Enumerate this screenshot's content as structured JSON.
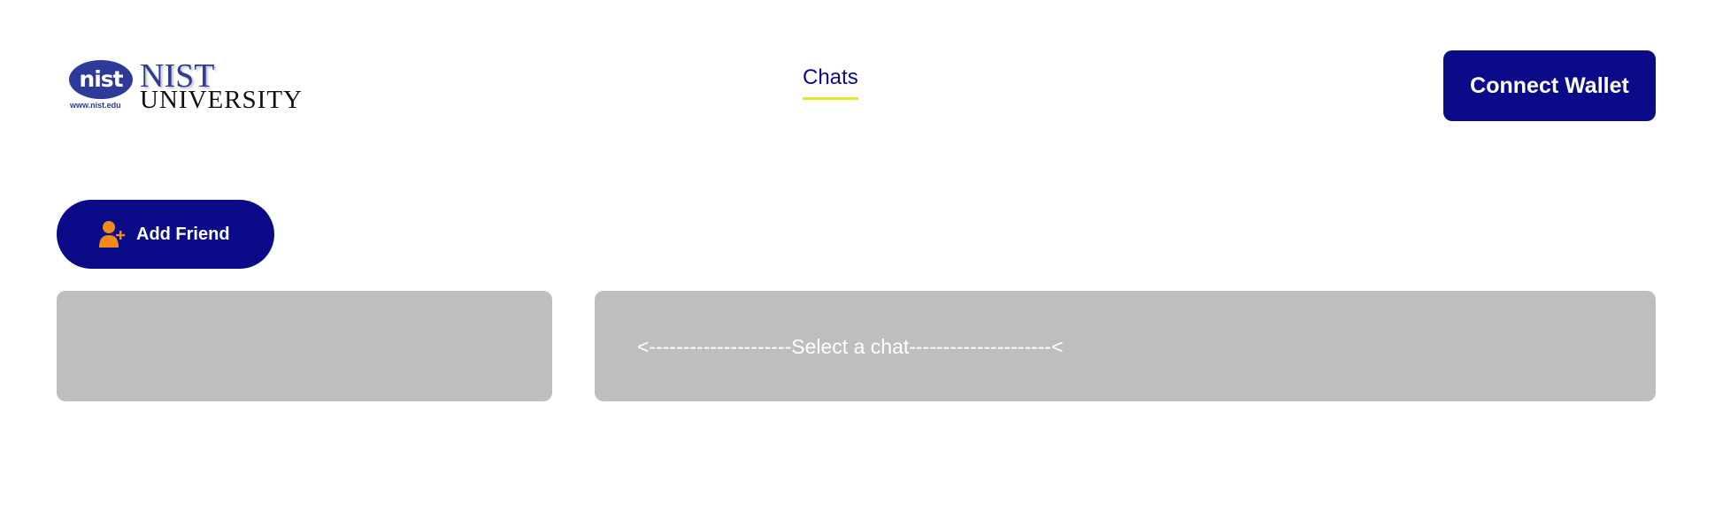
{
  "header": {
    "logo": {
      "mark_text": "nist",
      "url_text": "www.nist.edu",
      "name_line1": "NIST",
      "name_line2": "UNIVERSITY"
    },
    "nav": {
      "chats_label": "Chats"
    },
    "connect_wallet_label": "Connect Wallet"
  },
  "actions": {
    "add_friend_label": "Add Friend",
    "add_friend_icon": "add-user-icon"
  },
  "chat": {
    "placeholder": "<---------------------Select a chat---------------------<"
  },
  "colors": {
    "primary": "#0b0b8a",
    "accent_underline": "#e8e51b",
    "icon_orange": "#f28a1a",
    "panel_bg": "#bebebe",
    "logo_blue": "#2e3a97"
  }
}
